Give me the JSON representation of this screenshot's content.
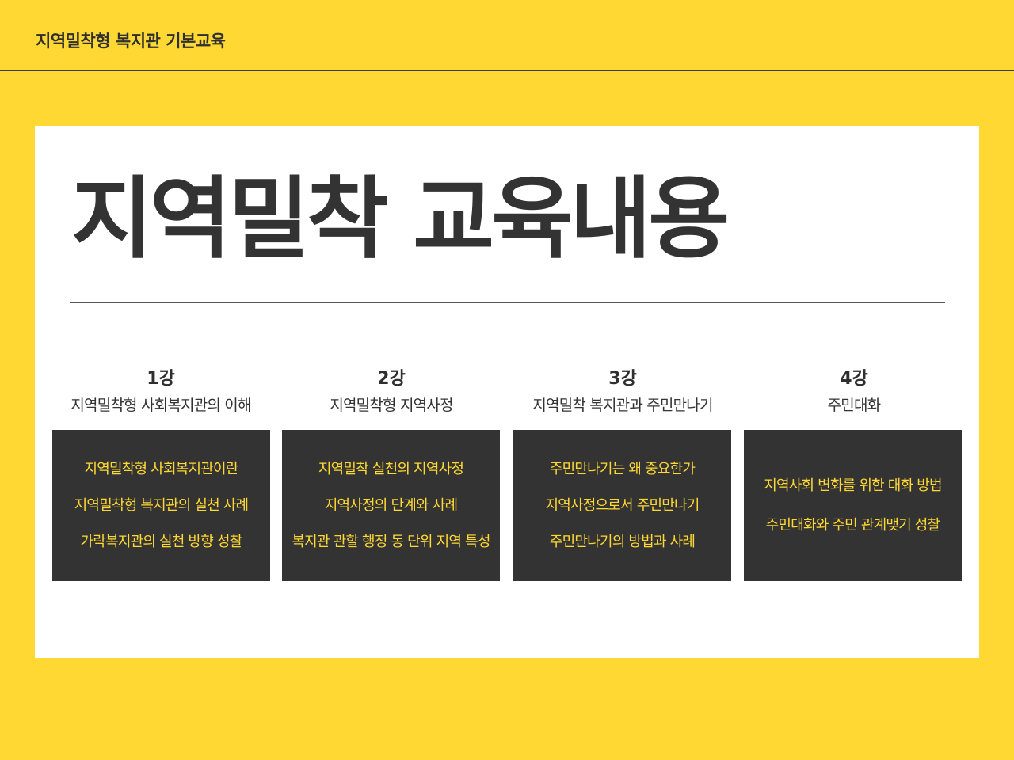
{
  "header": {
    "title": "지역밀착형 복지관 기본교육"
  },
  "main": {
    "title": "지역밀착 교육내용",
    "lectures": [
      {
        "number": "1강",
        "title": "지역밀착형 사회복지관의 이해",
        "items": [
          "지역밀착형 사회복지관이란",
          "지역밀착형 복지관의 실천 사례",
          "가락복지관의 실천 방향 성찰"
        ]
      },
      {
        "number": "2강",
        "title": "지역밀착형 지역사정",
        "items": [
          "지역밀착 실천의 지역사정",
          "지역사정의 단계와 사례",
          "복지관 관할 행정 동 단위 지역 특성"
        ]
      },
      {
        "number": "3강",
        "title": "지역밀착 복지관과 주민만나기",
        "items": [
          "주민만나기는 왜 중요한가",
          "지역사정으로서 주민만나기",
          "주민만나기의 방법과 사례"
        ]
      },
      {
        "number": "4강",
        "title": "주민대화",
        "items": [
          "지역사회 변화를 위한 대화 방법",
          "주민대화와 주민 관계맺기 성찰"
        ]
      }
    ]
  },
  "colors": {
    "background": "#FFD833",
    "card": "#FFFFFF",
    "box": "#333333",
    "box_text": "#FFD833",
    "text": "#333333"
  }
}
